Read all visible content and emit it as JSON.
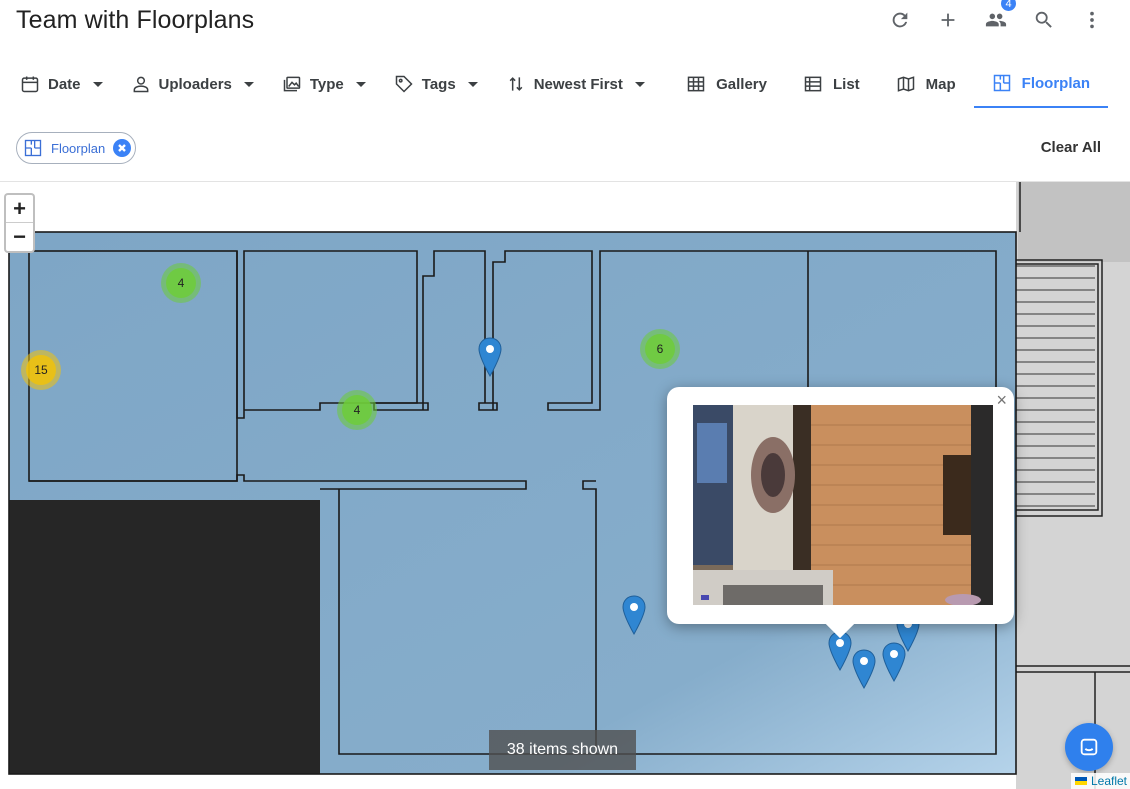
{
  "header": {
    "title": "Team with Floorplans",
    "members_badge": "4",
    "actions": [
      "refresh-icon",
      "plus-icon",
      "people-icon",
      "search-icon",
      "more-vert-icon"
    ]
  },
  "filters": [
    {
      "label": "Date",
      "icon": "calendar-icon"
    },
    {
      "label": "Uploaders",
      "icon": "person-icon"
    },
    {
      "label": "Type",
      "icon": "images-icon"
    },
    {
      "label": "Tags",
      "icon": "tag-icon"
    },
    {
      "label": "Newest First",
      "icon": "sort-icon"
    }
  ],
  "views": [
    {
      "label": "Gallery",
      "icon": "grid-icon",
      "active": false
    },
    {
      "label": "List",
      "icon": "list-icon",
      "active": false
    },
    {
      "label": "Map",
      "icon": "map-icon",
      "active": false
    },
    {
      "label": "Floorplan",
      "icon": "floorplan-icon",
      "active": true
    }
  ],
  "chips": {
    "active_filter": "Floorplan",
    "clear_all": "Clear All"
  },
  "map": {
    "zoom_in": "+",
    "zoom_out": "−",
    "clusters": [
      "4",
      "15",
      "4",
      "6"
    ],
    "items_shown": "38 items shown",
    "popup_close": "×",
    "attribution": "Leaflet"
  },
  "colors": {
    "accent": "#3b82f6",
    "floor_overlay": "#7fa7c6",
    "cluster_green": "#6ecc39",
    "cluster_yellow": "#f0c20c"
  }
}
